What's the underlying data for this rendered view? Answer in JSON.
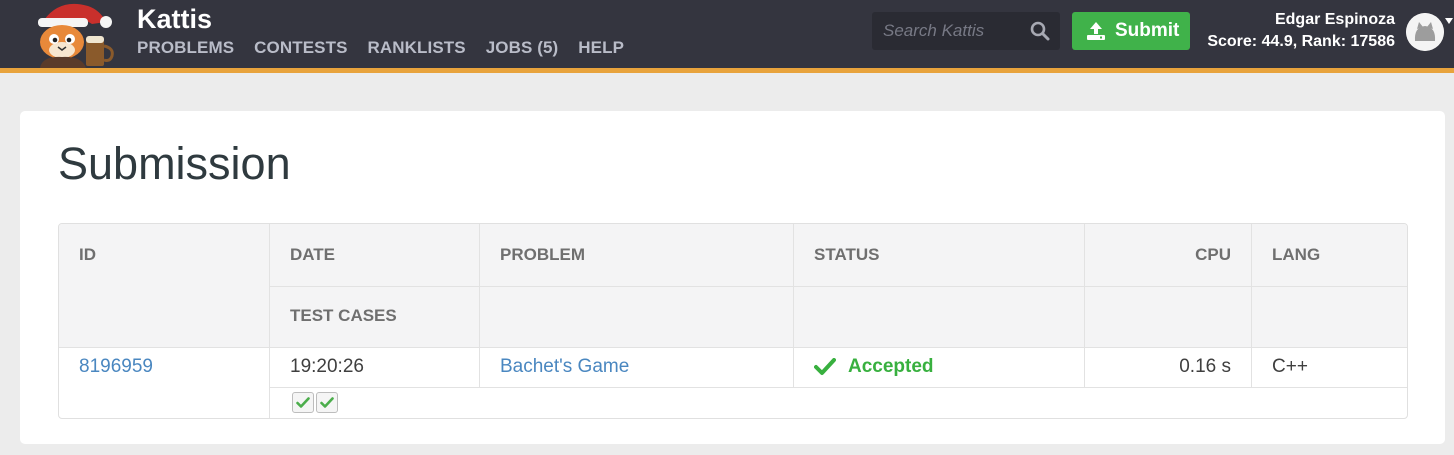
{
  "header": {
    "brand": "Kattis",
    "nav": [
      "PROBLEMS",
      "CONTESTS",
      "RANKLISTS",
      "JOBS (5)",
      "HELP"
    ],
    "search_placeholder": "Search Kattis",
    "submit_label": "Submit",
    "user_name": "Edgar Espinoza",
    "user_score": "Score: 44.9, Rank: 17586"
  },
  "page": {
    "title": "Submission"
  },
  "table": {
    "headers": {
      "id": "ID",
      "date": "DATE",
      "problem": "PROBLEM",
      "status": "STATUS",
      "cpu": "CPU",
      "lang": "LANG",
      "test_cases": "TEST CASES"
    },
    "row": {
      "id": "8196959",
      "date": "19:20:26",
      "problem": "Bachet's Game",
      "status": "Accepted",
      "cpu": "0.16 s",
      "lang": "C++",
      "test_case_icons": [
        "check-icon",
        "check-icon"
      ]
    }
  },
  "colors": {
    "header_bg": "#34353f",
    "accent_stripe": "#e8a33c",
    "submit_green": "#40b24a",
    "accepted_green": "#38b03f",
    "link_blue": "#4a87c0"
  }
}
